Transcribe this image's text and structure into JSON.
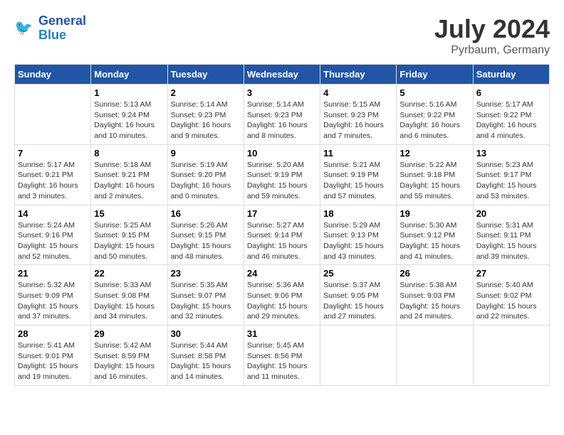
{
  "header": {
    "logo_line1": "General",
    "logo_line2": "Blue",
    "month_title": "July 2024",
    "subtitle": "Pyrbaum, Germany"
  },
  "days_of_week": [
    "Sunday",
    "Monday",
    "Tuesday",
    "Wednesday",
    "Thursday",
    "Friday",
    "Saturday"
  ],
  "weeks": [
    [
      {
        "day": "",
        "info": ""
      },
      {
        "day": "1",
        "info": "Sunrise: 5:13 AM\nSunset: 9:24 PM\nDaylight: 16 hours\nand 10 minutes."
      },
      {
        "day": "2",
        "info": "Sunrise: 5:14 AM\nSunset: 9:23 PM\nDaylight: 16 hours\nand 9 minutes."
      },
      {
        "day": "3",
        "info": "Sunrise: 5:14 AM\nSunset: 9:23 PM\nDaylight: 16 hours\nand 8 minutes."
      },
      {
        "day": "4",
        "info": "Sunrise: 5:15 AM\nSunset: 9:23 PM\nDaylight: 16 hours\nand 7 minutes."
      },
      {
        "day": "5",
        "info": "Sunrise: 5:16 AM\nSunset: 9:22 PM\nDaylight: 16 hours\nand 6 minutes."
      },
      {
        "day": "6",
        "info": "Sunrise: 5:17 AM\nSunset: 9:22 PM\nDaylight: 16 hours\nand 4 minutes."
      }
    ],
    [
      {
        "day": "7",
        "info": "Sunrise: 5:17 AM\nSunset: 9:21 PM\nDaylight: 16 hours\nand 3 minutes."
      },
      {
        "day": "8",
        "info": "Sunrise: 5:18 AM\nSunset: 9:21 PM\nDaylight: 16 hours\nand 2 minutes."
      },
      {
        "day": "9",
        "info": "Sunrise: 5:19 AM\nSunset: 9:20 PM\nDaylight: 16 hours\nand 0 minutes."
      },
      {
        "day": "10",
        "info": "Sunrise: 5:20 AM\nSunset: 9:19 PM\nDaylight: 15 hours\nand 59 minutes."
      },
      {
        "day": "11",
        "info": "Sunrise: 5:21 AM\nSunset: 9:19 PM\nDaylight: 15 hours\nand 57 minutes."
      },
      {
        "day": "12",
        "info": "Sunrise: 5:22 AM\nSunset: 9:18 PM\nDaylight: 15 hours\nand 55 minutes."
      },
      {
        "day": "13",
        "info": "Sunrise: 5:23 AM\nSunset: 9:17 PM\nDaylight: 15 hours\nand 53 minutes."
      }
    ],
    [
      {
        "day": "14",
        "info": "Sunrise: 5:24 AM\nSunset: 9:16 PM\nDaylight: 15 hours\nand 52 minutes."
      },
      {
        "day": "15",
        "info": "Sunrise: 5:25 AM\nSunset: 9:15 PM\nDaylight: 15 hours\nand 50 minutes."
      },
      {
        "day": "16",
        "info": "Sunrise: 5:26 AM\nSunset: 9:15 PM\nDaylight: 15 hours\nand 48 minutes."
      },
      {
        "day": "17",
        "info": "Sunrise: 5:27 AM\nSunset: 9:14 PM\nDaylight: 15 hours\nand 46 minutes."
      },
      {
        "day": "18",
        "info": "Sunrise: 5:29 AM\nSunset: 9:13 PM\nDaylight: 15 hours\nand 43 minutes."
      },
      {
        "day": "19",
        "info": "Sunrise: 5:30 AM\nSunset: 9:12 PM\nDaylight: 15 hours\nand 41 minutes."
      },
      {
        "day": "20",
        "info": "Sunrise: 5:31 AM\nSunset: 9:11 PM\nDaylight: 15 hours\nand 39 minutes."
      }
    ],
    [
      {
        "day": "21",
        "info": "Sunrise: 5:32 AM\nSunset: 9:09 PM\nDaylight: 15 hours\nand 37 minutes."
      },
      {
        "day": "22",
        "info": "Sunrise: 5:33 AM\nSunset: 9:08 PM\nDaylight: 15 hours\nand 34 minutes."
      },
      {
        "day": "23",
        "info": "Sunrise: 5:35 AM\nSunset: 9:07 PM\nDaylight: 15 hours\nand 32 minutes."
      },
      {
        "day": "24",
        "info": "Sunrise: 5:36 AM\nSunset: 9:06 PM\nDaylight: 15 hours\nand 29 minutes."
      },
      {
        "day": "25",
        "info": "Sunrise: 5:37 AM\nSunset: 9:05 PM\nDaylight: 15 hours\nand 27 minutes."
      },
      {
        "day": "26",
        "info": "Sunrise: 5:38 AM\nSunset: 9:03 PM\nDaylight: 15 hours\nand 24 minutes."
      },
      {
        "day": "27",
        "info": "Sunrise: 5:40 AM\nSunset: 9:02 PM\nDaylight: 15 hours\nand 22 minutes."
      }
    ],
    [
      {
        "day": "28",
        "info": "Sunrise: 5:41 AM\nSunset: 9:01 PM\nDaylight: 15 hours\nand 19 minutes."
      },
      {
        "day": "29",
        "info": "Sunrise: 5:42 AM\nSunset: 8:59 PM\nDaylight: 15 hours\nand 16 minutes."
      },
      {
        "day": "30",
        "info": "Sunrise: 5:44 AM\nSunset: 8:58 PM\nDaylight: 15 hours\nand 14 minutes."
      },
      {
        "day": "31",
        "info": "Sunrise: 5:45 AM\nSunset: 8:56 PM\nDaylight: 15 hours\nand 11 minutes."
      },
      {
        "day": "",
        "info": ""
      },
      {
        "day": "",
        "info": ""
      },
      {
        "day": "",
        "info": ""
      }
    ]
  ]
}
